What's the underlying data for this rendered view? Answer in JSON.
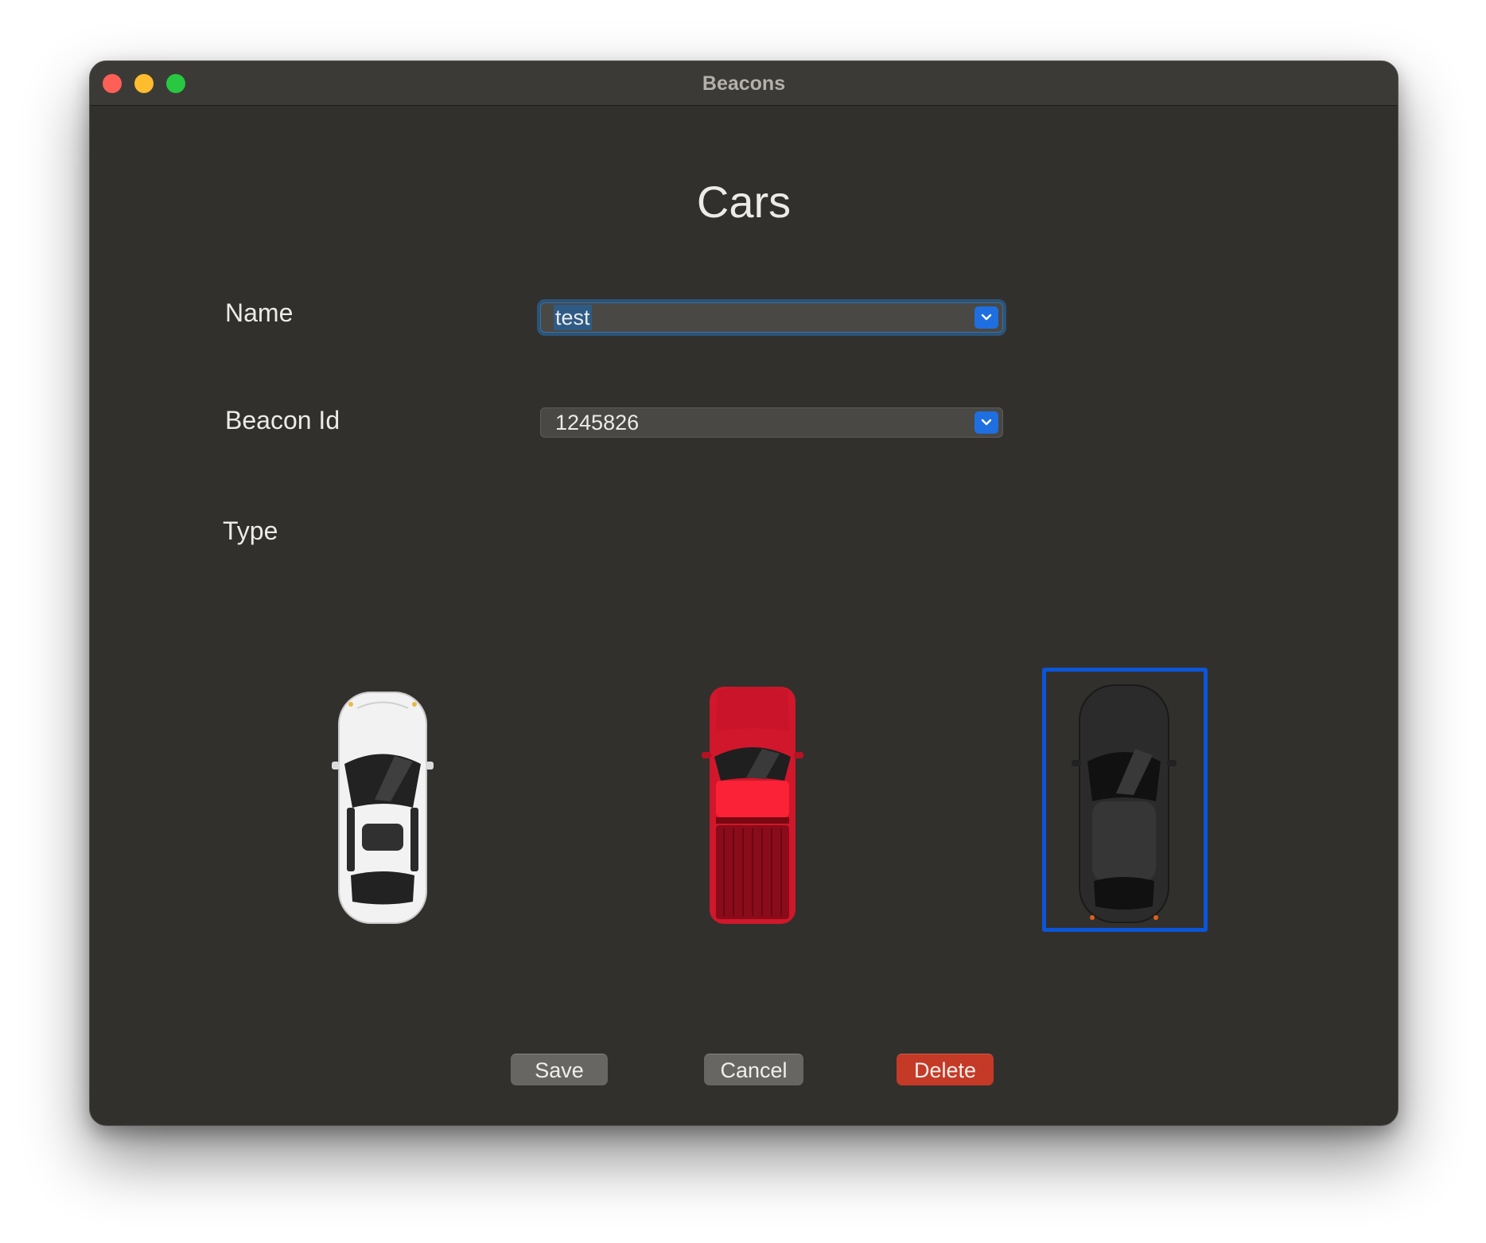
{
  "window": {
    "title": "Beacons",
    "controls": [
      "close",
      "minimize",
      "zoom"
    ]
  },
  "page": {
    "title": "Cars"
  },
  "form": {
    "name": {
      "label": "Name",
      "value": "test",
      "text_selected": true,
      "focused": true,
      "dropdown_icon": "chevron-down-icon"
    },
    "beacon_id": {
      "label": "Beacon Id",
      "value": "1245826",
      "dropdown_icon": "chevron-down-icon"
    },
    "type": {
      "label": "Type",
      "options": [
        {
          "name": "white-sedan",
          "color": "#f2f2f2"
        },
        {
          "name": "red-pickup",
          "color": "#e0162b"
        },
        {
          "name": "black-coupe",
          "color": "#2b2b2b"
        }
      ],
      "selected_index": 2
    }
  },
  "buttons": {
    "save": "Save",
    "cancel": "Cancel",
    "delete": "Delete"
  },
  "colors": {
    "accent": "#0d55d8",
    "delete": "#c43a26",
    "window_bg": "#32302d"
  }
}
